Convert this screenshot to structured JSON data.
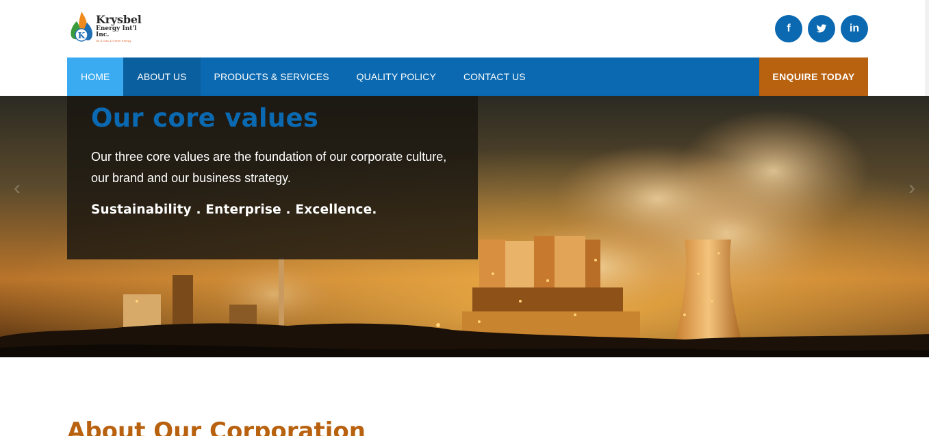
{
  "brand": {
    "name": "Krysbel",
    "sub": "Energy Int'l Inc.",
    "tagline": "Oil & Gas & Green Energy"
  },
  "social": [
    {
      "icon": "facebook-icon",
      "glyph": "f"
    },
    {
      "icon": "twitter-icon",
      "glyph": "t"
    },
    {
      "icon": "linkedin-icon",
      "glyph": "in"
    }
  ],
  "nav": {
    "items": [
      {
        "label": "HOME"
      },
      {
        "label": "ABOUT US"
      },
      {
        "label": "PRODUCTS & SERVICES"
      },
      {
        "label": "QUALITY POLICY"
      },
      {
        "label": "CONTACT US"
      }
    ],
    "cta": "ENQUIRE TODAY"
  },
  "hero": {
    "title": "Our core values",
    "text": "Our three core values are the foundation of our corporate culture, our brand and our business strategy.",
    "values": "Sustainability . Enterprise . Excellence."
  },
  "about": {
    "title": "About Our Corporation"
  },
  "colors": {
    "primary": "#0a69b0",
    "active": "#3aabf1",
    "accent": "#b8610f"
  }
}
